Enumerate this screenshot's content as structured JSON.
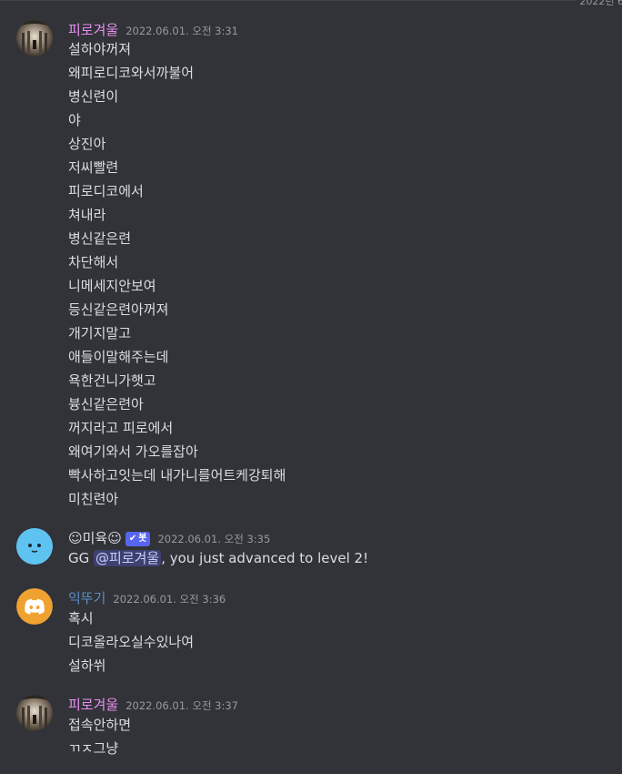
{
  "colors": {
    "background": "#313338",
    "user_pink": "#e88ef0",
    "user_blue": "#5b8ec7",
    "bot_name": "#dbdee1",
    "timestamp": "#949ba4",
    "bot_tag": "#5865f2"
  },
  "top_date_fragment": "2022년 6",
  "messages": [
    {
      "username": "피로겨울",
      "timestamp": "2022.06.01. 오전 3:31",
      "avatar_icon": "photo-avatar",
      "lines": [
        "설하야꺼져",
        "왜피로디코와서까불어",
        "병신련이",
        "야",
        "상진아",
        "저씨빨련",
        "피로디코에서",
        "쳐내라",
        "병신같은련",
        "차단해서",
        "니메세지안보여",
        "등신같은련아꺼져",
        "개기지말고",
        "애들이말해주는데",
        "욕한건니가햇고",
        "븅신같은련아",
        "꺼지라고 피로에서",
        "왜여기와서 가오를잡아",
        "빡사하고잇는데 내가니를어트케강퇴해",
        "미친련아"
      ]
    },
    {
      "username": "☺미육☺",
      "bot_tag": "봇",
      "bot_check_icon": "check-icon",
      "timestamp": "2022.06.01. 오전 3:35",
      "avatar_icon": "bot-face-avatar",
      "text_prefix": "GG ",
      "mention": "@피로겨울",
      "text_suffix": ", you just advanced to level 2!"
    },
    {
      "username": "익뚜기",
      "timestamp": "2022.06.01. 오전 3:36",
      "avatar_icon": "discord-logo-avatar",
      "lines": [
        "혹시",
        "디코올라오실수있나여",
        "설하쒸"
      ]
    },
    {
      "username": "피로겨울",
      "timestamp": "2022.06.01. 오전 3:37",
      "avatar_icon": "photo-avatar",
      "lines": [
        "접속안하면",
        "ㄲㅈ그냥"
      ]
    }
  ]
}
